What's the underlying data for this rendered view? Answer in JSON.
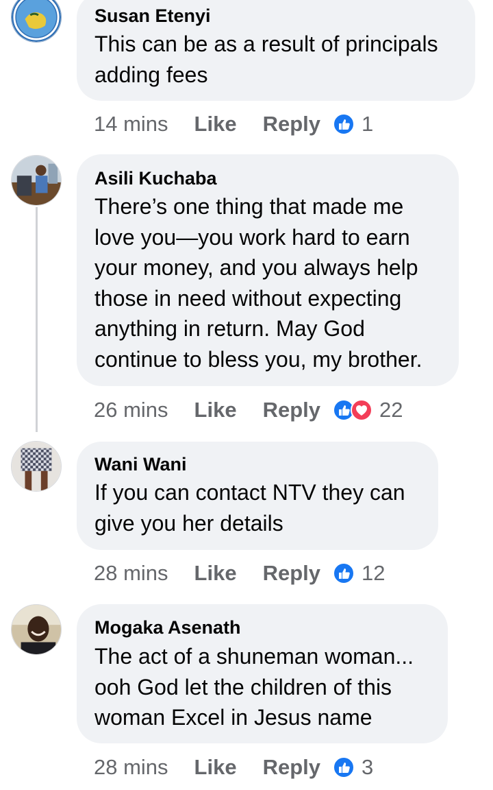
{
  "comments": [
    {
      "author": "Susan Etenyi",
      "text": "This can be as a result of principals\nadding fees",
      "avatar": "globe-avatar",
      "time": "14 mins",
      "like_label": "Like",
      "reply_label": "Reply",
      "reactions": [
        "like-icon"
      ],
      "reaction_count": "1"
    },
    {
      "author": "Asili Kuchaba",
      "text": "There’s one thing that made me\nlove you—you work hard to earn\nyour money, and you always help\nthose in need without expecting\nanything in return. May God\ncontinue to bless you, my brother.",
      "avatar": "photo-avatar",
      "time": "26 mins",
      "like_label": "Like",
      "reply_label": "Reply",
      "reactions": [
        "like-icon",
        "love-icon"
      ],
      "reaction_count": "22"
    },
    {
      "author": "Wani Wani",
      "text": "If you can contact NTV they can\ngive you her details",
      "avatar": "photo-avatar",
      "time": "28 mins",
      "like_label": "Like",
      "reply_label": "Reply",
      "reactions": [
        "like-icon"
      ],
      "reaction_count": "12"
    },
    {
      "author": "Mogaka Asenath",
      "text": "The act of a shuneman woman...\nooh God  let the children of this\nwoman Excel in Jesus name",
      "avatar": "photo-avatar",
      "time": "28 mins",
      "like_label": "Like",
      "reply_label": "Reply",
      "reactions": [
        "like-icon"
      ],
      "reaction_count": "3"
    }
  ],
  "colors": {
    "bubble": "#f0f2f5",
    "meta_text": "#65676b",
    "like_blue": "#1877f2",
    "love_red": "#f33e58"
  }
}
